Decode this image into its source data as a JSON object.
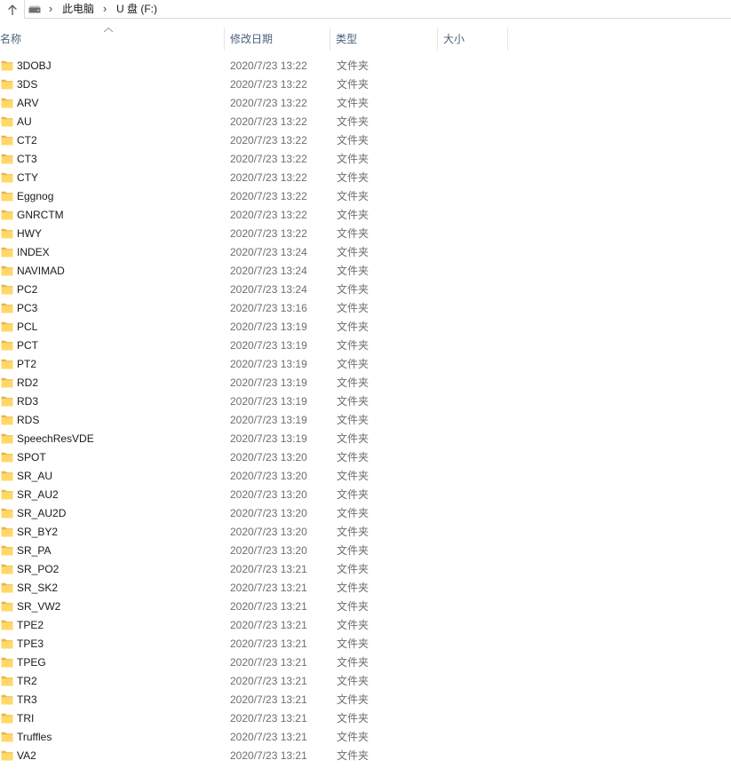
{
  "address_bar": {
    "separator": "›",
    "breadcrumbs": [
      "此电脑",
      "U 盘 (F:)"
    ]
  },
  "columns": [
    {
      "key": "name",
      "label": "名称"
    },
    {
      "key": "modified",
      "label": "修改日期"
    },
    {
      "key": "type",
      "label": "类型"
    },
    {
      "key": "size",
      "label": "大小"
    }
  ],
  "icons": {
    "up": "up-arrow-icon",
    "location": "drive-icon",
    "sort": "chevron-up-icon",
    "row": "folder-icon"
  },
  "colors": {
    "folder_body": "#FFD867",
    "folder_tab": "#E8B54A",
    "name_text": "#1a1a1a",
    "secondary_text": "#6d6d6d",
    "header_text": "#4c607a",
    "divider": "#e5e5e5"
  },
  "files": [
    {
      "name": "3DOBJ",
      "modified": "2020/7/23 13:22",
      "type": "文件夹"
    },
    {
      "name": "3DS",
      "modified": "2020/7/23 13:22",
      "type": "文件夹"
    },
    {
      "name": "ARV",
      "modified": "2020/7/23 13:22",
      "type": "文件夹"
    },
    {
      "name": "AU",
      "modified": "2020/7/23 13:22",
      "type": "文件夹"
    },
    {
      "name": "CT2",
      "modified": "2020/7/23 13:22",
      "type": "文件夹"
    },
    {
      "name": "CT3",
      "modified": "2020/7/23 13:22",
      "type": "文件夹"
    },
    {
      "name": "CTY",
      "modified": "2020/7/23 13:22",
      "type": "文件夹"
    },
    {
      "name": "Eggnog",
      "modified": "2020/7/23 13:22",
      "type": "文件夹"
    },
    {
      "name": "GNRCTM",
      "modified": "2020/7/23 13:22",
      "type": "文件夹"
    },
    {
      "name": "HWY",
      "modified": "2020/7/23 13:22",
      "type": "文件夹"
    },
    {
      "name": "INDEX",
      "modified": "2020/7/23 13:24",
      "type": "文件夹"
    },
    {
      "name": "NAVIMAD",
      "modified": "2020/7/23 13:24",
      "type": "文件夹"
    },
    {
      "name": "PC2",
      "modified": "2020/7/23 13:24",
      "type": "文件夹"
    },
    {
      "name": "PC3",
      "modified": "2020/7/23 13:16",
      "type": "文件夹"
    },
    {
      "name": "PCL",
      "modified": "2020/7/23 13:19",
      "type": "文件夹"
    },
    {
      "name": "PCT",
      "modified": "2020/7/23 13:19",
      "type": "文件夹"
    },
    {
      "name": "PT2",
      "modified": "2020/7/23 13:19",
      "type": "文件夹"
    },
    {
      "name": "RD2",
      "modified": "2020/7/23 13:19",
      "type": "文件夹"
    },
    {
      "name": "RD3",
      "modified": "2020/7/23 13:19",
      "type": "文件夹"
    },
    {
      "name": "RDS",
      "modified": "2020/7/23 13:19",
      "type": "文件夹"
    },
    {
      "name": "SpeechResVDE",
      "modified": "2020/7/23 13:19",
      "type": "文件夹"
    },
    {
      "name": "SPOT",
      "modified": "2020/7/23 13:20",
      "type": "文件夹"
    },
    {
      "name": "SR_AU",
      "modified": "2020/7/23 13:20",
      "type": "文件夹"
    },
    {
      "name": "SR_AU2",
      "modified": "2020/7/23 13:20",
      "type": "文件夹"
    },
    {
      "name": "SR_AU2D",
      "modified": "2020/7/23 13:20",
      "type": "文件夹"
    },
    {
      "name": "SR_BY2",
      "modified": "2020/7/23 13:20",
      "type": "文件夹"
    },
    {
      "name": "SR_PA",
      "modified": "2020/7/23 13:20",
      "type": "文件夹"
    },
    {
      "name": "SR_PO2",
      "modified": "2020/7/23 13:21",
      "type": "文件夹"
    },
    {
      "name": "SR_SK2",
      "modified": "2020/7/23 13:21",
      "type": "文件夹"
    },
    {
      "name": "SR_VW2",
      "modified": "2020/7/23 13:21",
      "type": "文件夹"
    },
    {
      "name": "TPE2",
      "modified": "2020/7/23 13:21",
      "type": "文件夹"
    },
    {
      "name": "TPE3",
      "modified": "2020/7/23 13:21",
      "type": "文件夹"
    },
    {
      "name": "TPEG",
      "modified": "2020/7/23 13:21",
      "type": "文件夹"
    },
    {
      "name": "TR2",
      "modified": "2020/7/23 13:21",
      "type": "文件夹"
    },
    {
      "name": "TR3",
      "modified": "2020/7/23 13:21",
      "type": "文件夹"
    },
    {
      "name": "TRI",
      "modified": "2020/7/23 13:21",
      "type": "文件夹"
    },
    {
      "name": "Truffles",
      "modified": "2020/7/23 13:21",
      "type": "文件夹"
    },
    {
      "name": "VA2",
      "modified": "2020/7/23 13:21",
      "type": "文件夹"
    }
  ]
}
